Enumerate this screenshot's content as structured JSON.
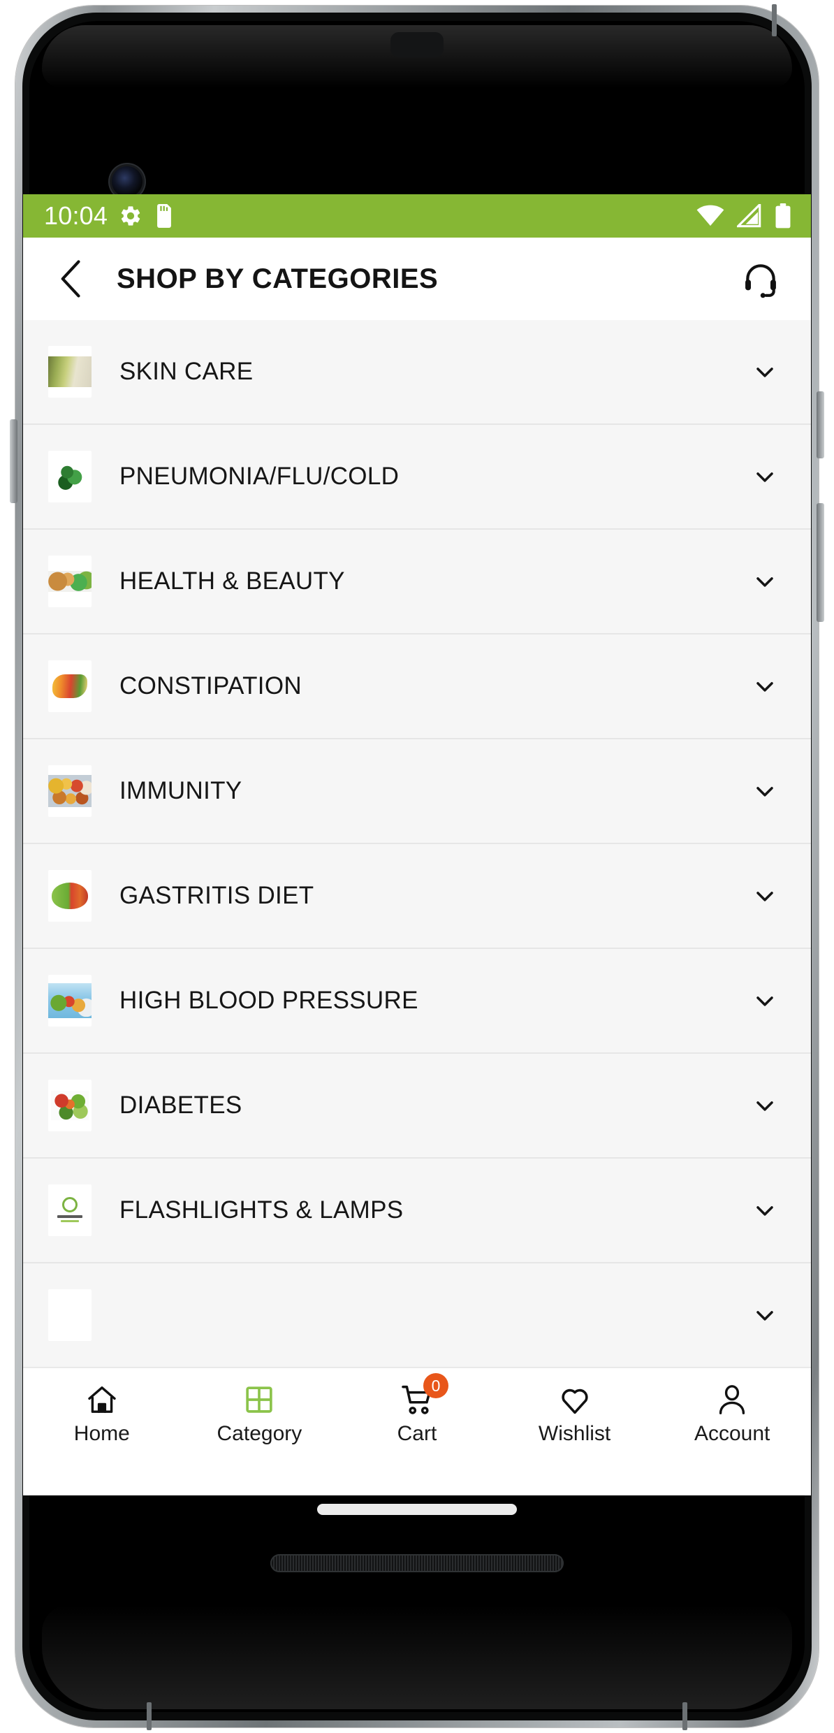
{
  "theme": {
    "brand_green": "#86b734",
    "badge_orange": "#e8561a",
    "list_bg": "#f6f6f6",
    "text_dark": "#161616"
  },
  "status_bar": {
    "time": "10:04",
    "left_icons": [
      "gear-icon",
      "sd-card-icon"
    ],
    "right_icons": [
      "wifi-icon",
      "cellular-signal-icon",
      "battery-icon"
    ]
  },
  "app_bar": {
    "back_icon": "chevron-left-icon",
    "title": "SHOP BY CATEGORIES",
    "support_icon": "headset-icon"
  },
  "categories": {
    "items": [
      {
        "label": "SKIN CARE",
        "expand_icon": "chevron-down-icon",
        "thumb": "skin-care-thumb"
      },
      {
        "label": "PNEUMONIA/FLU/COLD",
        "expand_icon": "chevron-down-icon",
        "thumb": "pneumonia-flu-cold-thumb"
      },
      {
        "label": "HEALTH & BEAUTY",
        "expand_icon": "chevron-down-icon",
        "thumb": "health-beauty-thumb"
      },
      {
        "label": "CONSTIPATION",
        "expand_icon": "chevron-down-icon",
        "thumb": "constipation-thumb"
      },
      {
        "label": "IMMUNITY",
        "expand_icon": "chevron-down-icon",
        "thumb": "immunity-thumb"
      },
      {
        "label": "GASTRITIS DIET",
        "expand_icon": "chevron-down-icon",
        "thumb": "gastritis-diet-thumb"
      },
      {
        "label": "HIGH BLOOD PRESSURE",
        "expand_icon": "chevron-down-icon",
        "thumb": "high-blood-pressure-thumb"
      },
      {
        "label": "DIABETES",
        "expand_icon": "chevron-down-icon",
        "thumb": "diabetes-thumb"
      },
      {
        "label": "FLASHLIGHTS & LAMPS",
        "expand_icon": "chevron-down-icon",
        "thumb": "flashlights-lamps-thumb"
      },
      {
        "label": "",
        "expand_icon": "chevron-down-icon",
        "thumb": "partial-thumb"
      }
    ]
  },
  "bottom_nav": {
    "items": [
      {
        "label": "Home",
        "icon": "home-icon",
        "active": false,
        "badge": null
      },
      {
        "label": "Category",
        "icon": "grid-icon",
        "active": true,
        "badge": null
      },
      {
        "label": "Cart",
        "icon": "cart-icon",
        "active": false,
        "badge": "0"
      },
      {
        "label": "Wishlist",
        "icon": "heart-icon",
        "active": false,
        "badge": null
      },
      {
        "label": "Account",
        "icon": "person-icon",
        "active": false,
        "badge": null
      }
    ]
  }
}
